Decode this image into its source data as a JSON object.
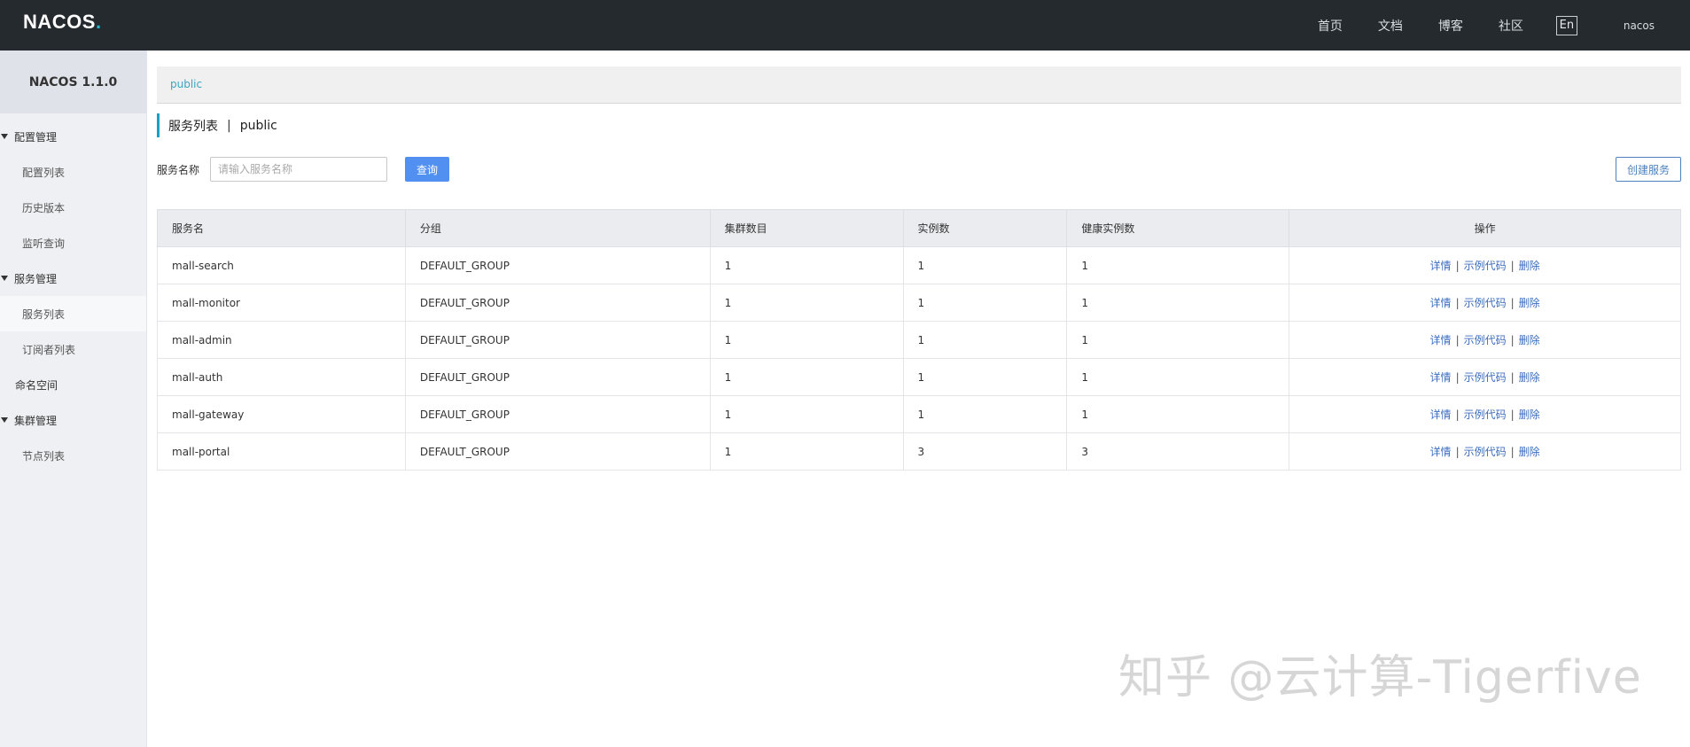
{
  "header": {
    "logo_text": "NACOS",
    "logo_dot": ".",
    "nav": [
      {
        "label": "首页"
      },
      {
        "label": "文档"
      },
      {
        "label": "博客"
      },
      {
        "label": "社区"
      }
    ],
    "lang_button": "En",
    "username": "nacos"
  },
  "sidebar": {
    "title": "NACOS 1.1.0",
    "groups": {
      "config": {
        "label": "配置管理",
        "items": [
          "配置列表",
          "历史版本",
          "监听查询"
        ]
      },
      "service": {
        "label": "服务管理",
        "items": [
          "服务列表",
          "订阅者列表"
        ]
      },
      "namespace": {
        "label": "命名空间"
      },
      "cluster": {
        "label": "集群管理",
        "items": [
          "节点列表"
        ]
      }
    }
  },
  "namespace_bar": {
    "current": "public"
  },
  "page": {
    "title": "服务列表",
    "separator": "|",
    "namespace": "public"
  },
  "search": {
    "label": "服务名称",
    "placeholder": "请输入服务名称",
    "query_button": "查询",
    "create_button": "创建服务"
  },
  "table": {
    "headers": [
      "服务名",
      "分组",
      "集群数目",
      "实例数",
      "健康实例数",
      "操作"
    ],
    "actions": {
      "detail": "详情",
      "sample": "示例代码",
      "delete": "删除",
      "sep": "|"
    },
    "rows": [
      {
        "name": "mall-search",
        "group": "DEFAULT_GROUP",
        "clusters": "1",
        "instances": "1",
        "healthy": "1"
      },
      {
        "name": "mall-monitor",
        "group": "DEFAULT_GROUP",
        "clusters": "1",
        "instances": "1",
        "healthy": "1"
      },
      {
        "name": "mall-admin",
        "group": "DEFAULT_GROUP",
        "clusters": "1",
        "instances": "1",
        "healthy": "1"
      },
      {
        "name": "mall-auth",
        "group": "DEFAULT_GROUP",
        "clusters": "1",
        "instances": "1",
        "healthy": "1"
      },
      {
        "name": "mall-gateway",
        "group": "DEFAULT_GROUP",
        "clusters": "1",
        "instances": "1",
        "healthy": "1"
      },
      {
        "name": "mall-portal",
        "group": "DEFAULT_GROUP",
        "clusters": "1",
        "instances": "3",
        "healthy": "3"
      }
    ]
  },
  "watermark": "知乎 @云计算-Tigerfive",
  "colors": {
    "topbar": "#252a2f",
    "accent": "#19a0c6",
    "primary_button": "#5190f0",
    "link": "#3c6dbe"
  }
}
